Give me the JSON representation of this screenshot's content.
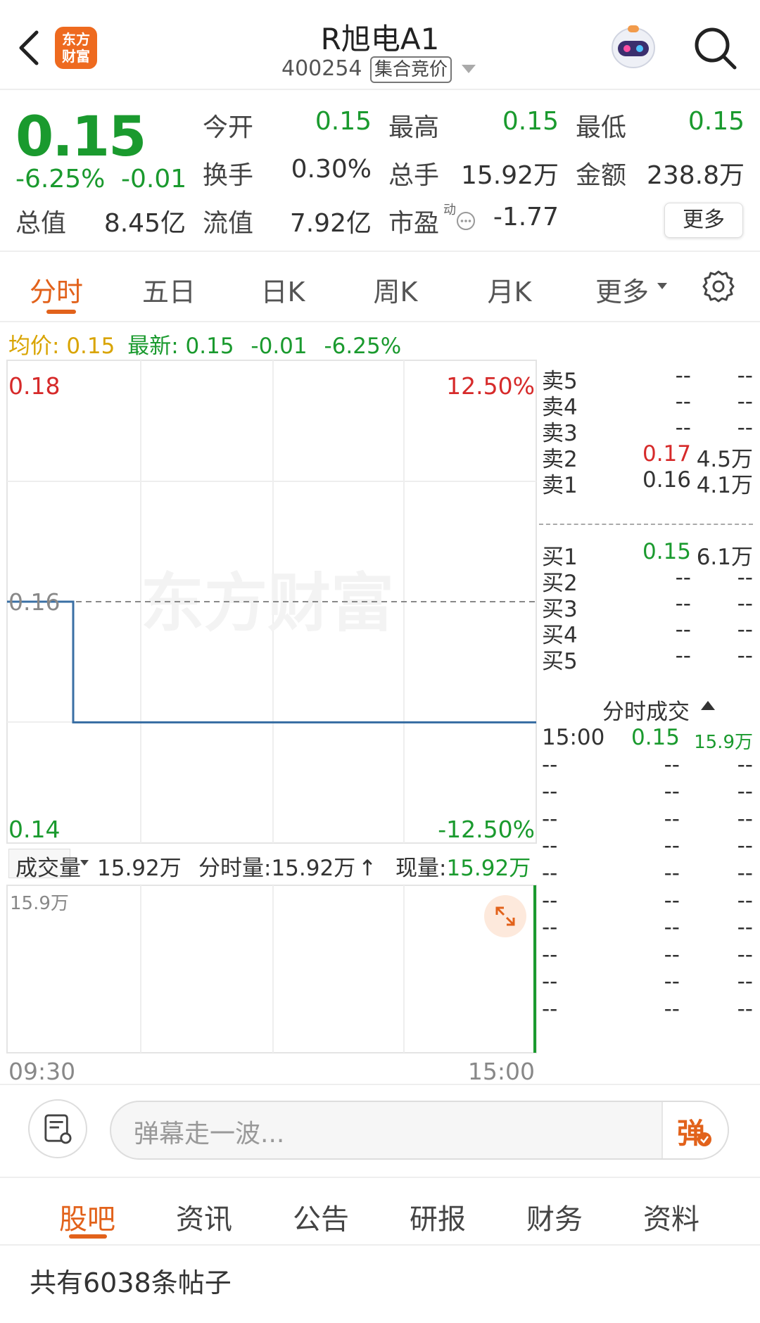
{
  "header": {
    "title": "R旭电A1",
    "code": "400254",
    "code_tag": "集合竞价",
    "logo_text_1": "东方",
    "logo_text_2": "财富"
  },
  "quote": {
    "price": "0.15",
    "change_pct": "-6.25%",
    "change_val": "-0.01",
    "rows": [
      [
        {
          "label": "今开",
          "value": "0.15",
          "color": "green"
        },
        {
          "label": "最高",
          "value": "0.15",
          "color": "green"
        },
        {
          "label": "最低",
          "value": "0.15",
          "color": "green"
        }
      ],
      [
        {
          "label": "换手",
          "value": "0.30%",
          "color": "dark"
        },
        {
          "label": "总手",
          "value": "15.92万",
          "color": "dark"
        },
        {
          "label": "金额",
          "value": "238.8万",
          "color": "dark"
        }
      ]
    ],
    "total_value_label": "总值",
    "total_value": "8.45亿",
    "float_value_label": "流值",
    "float_value": "7.92亿",
    "pe_label": "市盈",
    "pe_sup": "动",
    "pe_value": "-1.77",
    "more_label": "更多"
  },
  "chart_tabs": [
    "分时",
    "五日",
    "日K",
    "周K",
    "月K",
    "更多"
  ],
  "avg_line": {
    "avg_label": "均价:",
    "avg_value": "0.15",
    "latest_label": "最新:",
    "latest_value": "0.15",
    "latest_change": "-0.01",
    "latest_pct": "-6.25%"
  },
  "chart_data": {
    "type": "line",
    "x": [
      "09:30",
      "10:00",
      "15:00"
    ],
    "series": [
      {
        "values": [
          0.16,
          0.15,
          0.15
        ]
      }
    ],
    "ylim": [
      0.14,
      0.18
    ],
    "y_tick_labels": [
      "0.18",
      "0.16",
      "0.14"
    ],
    "pct_tick_labels": [
      "12.50%",
      "-12.50%"
    ],
    "x_tick_labels": [
      "09:30",
      "15:00"
    ],
    "prev_close": 0.16,
    "watermark": "东方财富"
  },
  "volume": {
    "label": "成交量",
    "total": "15.92万",
    "intraday_label": "分时量:15.92万",
    "current_label": "现量:",
    "current_value": "15.92万",
    "axis_max": "15.9万"
  },
  "order_book": {
    "asks": [
      {
        "label": "卖5",
        "price": "--",
        "vol": "--",
        "color": "dark"
      },
      {
        "label": "卖4",
        "price": "--",
        "vol": "--",
        "color": "dark"
      },
      {
        "label": "卖3",
        "price": "--",
        "vol": "--",
        "color": "dark"
      },
      {
        "label": "卖2",
        "price": "0.17",
        "vol": "4.5万",
        "color": "red"
      },
      {
        "label": "卖1",
        "price": "0.16",
        "vol": "4.1万",
        "color": "dark"
      }
    ],
    "bids": [
      {
        "label": "买1",
        "price": "0.15",
        "vol": "6.1万",
        "color": "green"
      },
      {
        "label": "买2",
        "price": "--",
        "vol": "--",
        "color": "dark"
      },
      {
        "label": "买3",
        "price": "--",
        "vol": "--",
        "color": "dark"
      },
      {
        "label": "买4",
        "price": "--",
        "vol": "--",
        "color": "dark"
      },
      {
        "label": "买5",
        "price": "--",
        "vol": "--",
        "color": "dark"
      }
    ]
  },
  "ticks": {
    "header": "分时成交",
    "rows": [
      {
        "time": "15:00",
        "price": "0.15",
        "vol": "15.9万"
      },
      {
        "time": "--",
        "price": "--",
        "vol": "--"
      },
      {
        "time": "--",
        "price": "--",
        "vol": "--"
      },
      {
        "time": "--",
        "price": "--",
        "vol": "--"
      },
      {
        "time": "--",
        "price": "--",
        "vol": "--"
      },
      {
        "time": "--",
        "price": "--",
        "vol": "--"
      },
      {
        "time": "--",
        "price": "--",
        "vol": "--"
      },
      {
        "time": "--",
        "price": "--",
        "vol": "--"
      },
      {
        "time": "--",
        "price": "--",
        "vol": "--"
      },
      {
        "time": "--",
        "price": "--",
        "vol": "--"
      },
      {
        "time": "--",
        "price": "--",
        "vol": "--"
      }
    ]
  },
  "comment_bar": {
    "placeholder": "弹幕走一波...",
    "send_label": "弹"
  },
  "bottom_tabs": [
    "股吧",
    "资讯",
    "公告",
    "研报",
    "财务",
    "资料"
  ],
  "post_count": "共有6038条帖子",
  "colors": {
    "up": "#d62a2a",
    "down": "#1a9a2e",
    "accent": "#e2621b",
    "avg": "#d9a400",
    "price_line": "#3a6fa4"
  }
}
